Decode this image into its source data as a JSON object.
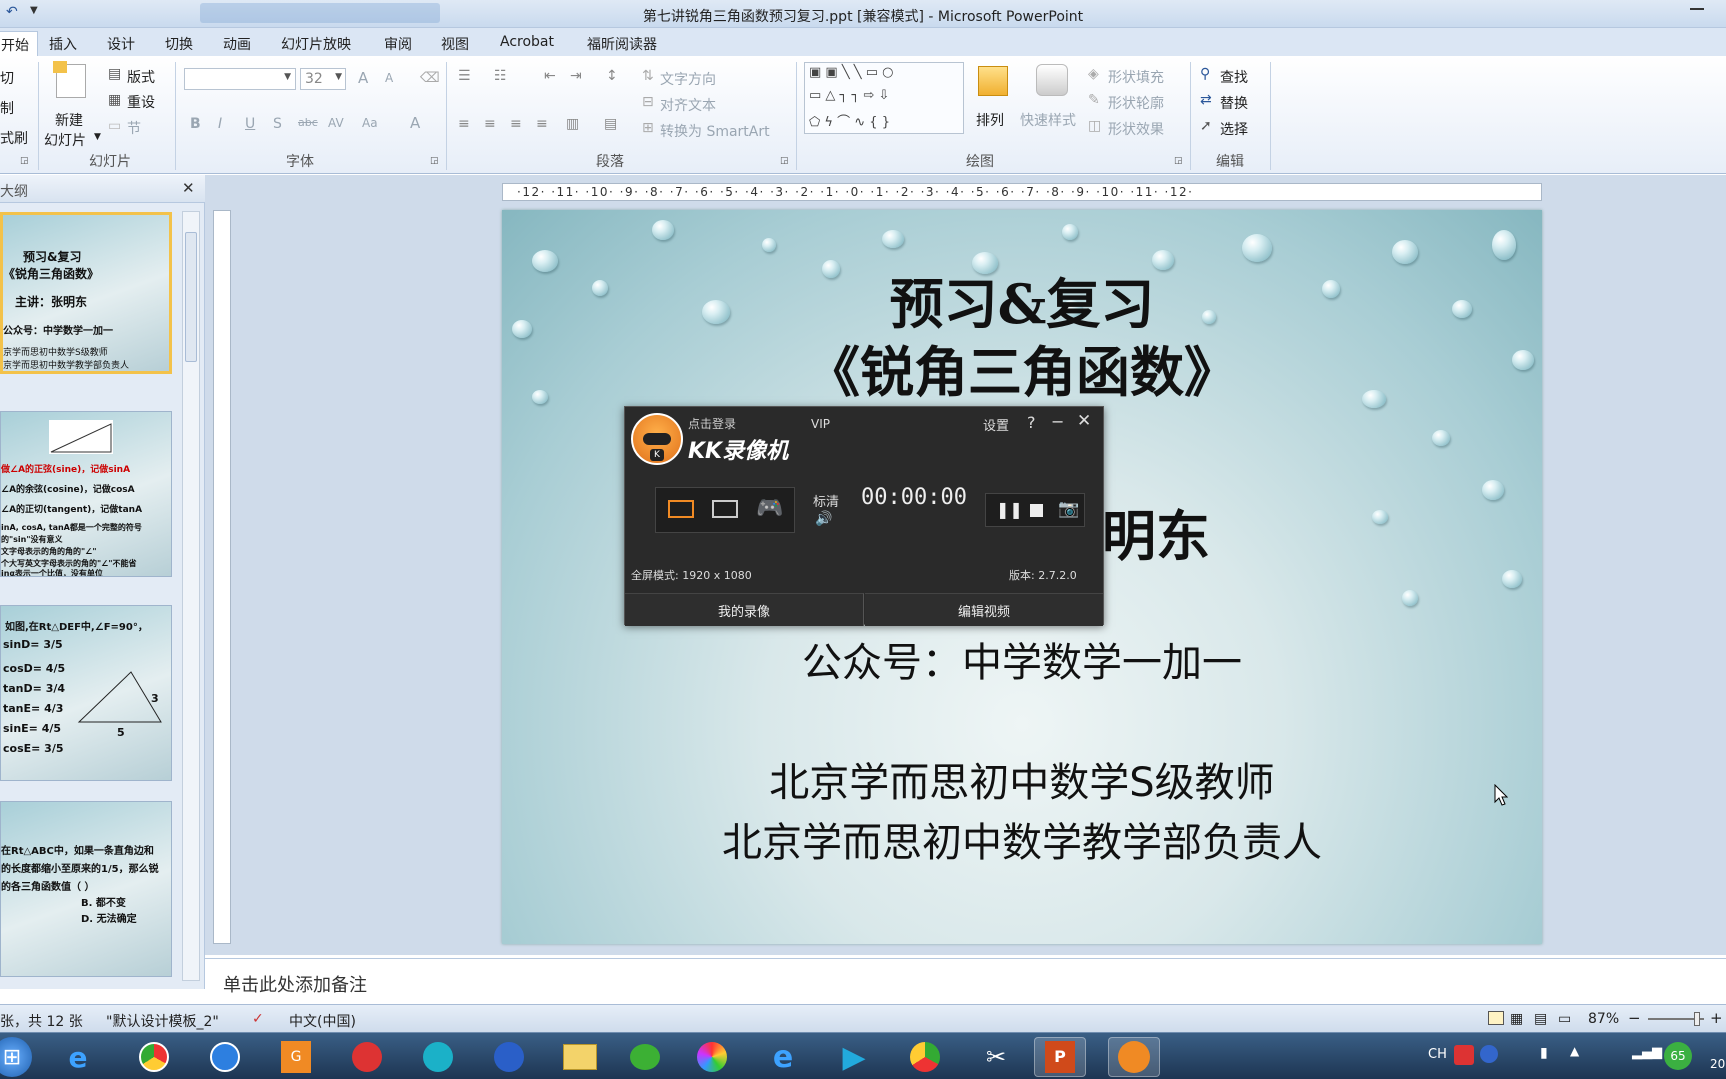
{
  "window": {
    "title": "第七讲锐角三角函数预习复习.ppt [兼容模式] - Microsoft PowerPoint",
    "qat_arrow": "▼"
  },
  "ribbon_tabs": [
    "开始",
    "插入",
    "设计",
    "切换",
    "动画",
    "幻灯片放映",
    "审阅",
    "视图",
    "Acrobat",
    "福昕阅读器"
  ],
  "ribbon": {
    "clipboard": {
      "cut": "切",
      "copy": "制",
      "format_painter": "式刷"
    },
    "slides": {
      "new_slide_line1": "新建",
      "new_slide_line2": "幻灯片",
      "layout": "版式",
      "reset": "重设",
      "section": "节",
      "group": "幻灯片"
    },
    "font": {
      "size": "32",
      "group": "字体",
      "bold": "B",
      "italic": "I",
      "underline": "U",
      "shadow": "S",
      "strike": "abc",
      "spacing": "AV",
      "case": "Aa",
      "color": "A",
      "grow": "A",
      "shrink": "A"
    },
    "paragraph": {
      "text_direction": "文字方向",
      "align_text": "对齐文本",
      "smartart": "转换为 SmartArt",
      "group": "段落"
    },
    "drawing": {
      "arrange": "排列",
      "quick_styles": "快速样式",
      "shape_fill": "形状填充",
      "shape_outline": "形状轮廓",
      "shape_effects": "形状效果",
      "group": "绘图"
    },
    "editing": {
      "find": "查找",
      "replace": "替换",
      "select": "选择",
      "group": "编辑"
    }
  },
  "left_pane": {
    "tab_label": "大纲",
    "close": "✕",
    "thumbs": [
      {
        "lines": [
          "预习&复习",
          "《锐角三角函数》",
          "主讲：张明东",
          "公众号：中学数学一加一",
          "京学而思初中数学S级教师",
          "京学而思初中数学教学部负责人"
        ]
      },
      {
        "lines": [
          "做∠A的正弦(sine)，记做sinA",
          "∠A的余弦(cosine)，记做cosA",
          "∠A的正切(tangent)，记做tanA",
          "inA, cosA, tanA都是一个完整的符号",
          "的\"sin\"没有意义",
          "文字母表示的角的角的\"∠\"",
          "个大写英文字母表示的角的\"∠\"不能省",
          "inα表示一个比值，没有单位"
        ]
      },
      {
        "lines": [
          "如图,在Rt△DEF中,∠F=90°，",
          "sinD= 3/5",
          "cosD= 4/5",
          "tanD= 3/4",
          "tanE= 4/3",
          "sinE= 4/5",
          "cosE= 3/5",
          "5",
          "3"
        ]
      },
      {
        "lines": [
          "在Rt△ABC中，如果一条直角边和",
          "的长度都缩小至原来的1/5，那么锐",
          "的各三角函数值（  ）",
          "B. 都不变",
          "D. 无法确定"
        ]
      }
    ]
  },
  "slide": {
    "title_line1": "预习&复习",
    "title_line2": "《锐角三角函数》",
    "presenter_fragment": "明东",
    "wechat": "公众号：中学数学一加一",
    "line1": "北京学而思初中数学S级教师",
    "line2": "北京学而思初中数学教学部负责人"
  },
  "ruler": {
    "h_ticks": "·12· ·11· ·10· ·9· ·8· ·7· ·6· ·5· ·4· ·3· ·2· ·1· ·0· ·1· ·2· ·3· ·4· ·5· ·6· ·7· ·8· ·9· ·10· ·11· ·12·"
  },
  "notes": {
    "placeholder": "单击此处添加备注"
  },
  "status": {
    "slide_count": "张，共 12 张",
    "theme": "\"默认设计模板_2\"",
    "language": "中文(中国)",
    "zoom": "87%",
    "zoom_minus": "−",
    "zoom_plus": "+"
  },
  "kk_recorder": {
    "login": "点击登录",
    "vip": "VIP",
    "settings": "设置",
    "help": "?",
    "minimize": "−",
    "close": "✕",
    "brand": "KK录像机",
    "quality": "标清",
    "timer": "00:00:00",
    "mode": "全屏模式: 1920 x 1080",
    "version": "版本: 2.7.2.0",
    "my_recordings": "我的录像",
    "edit_video": "编辑视频",
    "logo_letter": "K"
  },
  "taskbar": {
    "tray_lang": "CH",
    "tray_badge": "65",
    "clock_fragment": "20",
    "items": [
      "start-orb",
      "ie",
      "chrome",
      "app-blue",
      "pdf-g",
      "snail",
      "film",
      "media",
      "folder",
      "wechat",
      "pinwheel",
      "ie2",
      "play",
      "chrome-old",
      "tools",
      "powerpoint",
      "kk"
    ]
  },
  "colors": {
    "accent": "#2b579a",
    "selected_thumb": "#f3c24a",
    "kk_orange": "#f08a24"
  }
}
